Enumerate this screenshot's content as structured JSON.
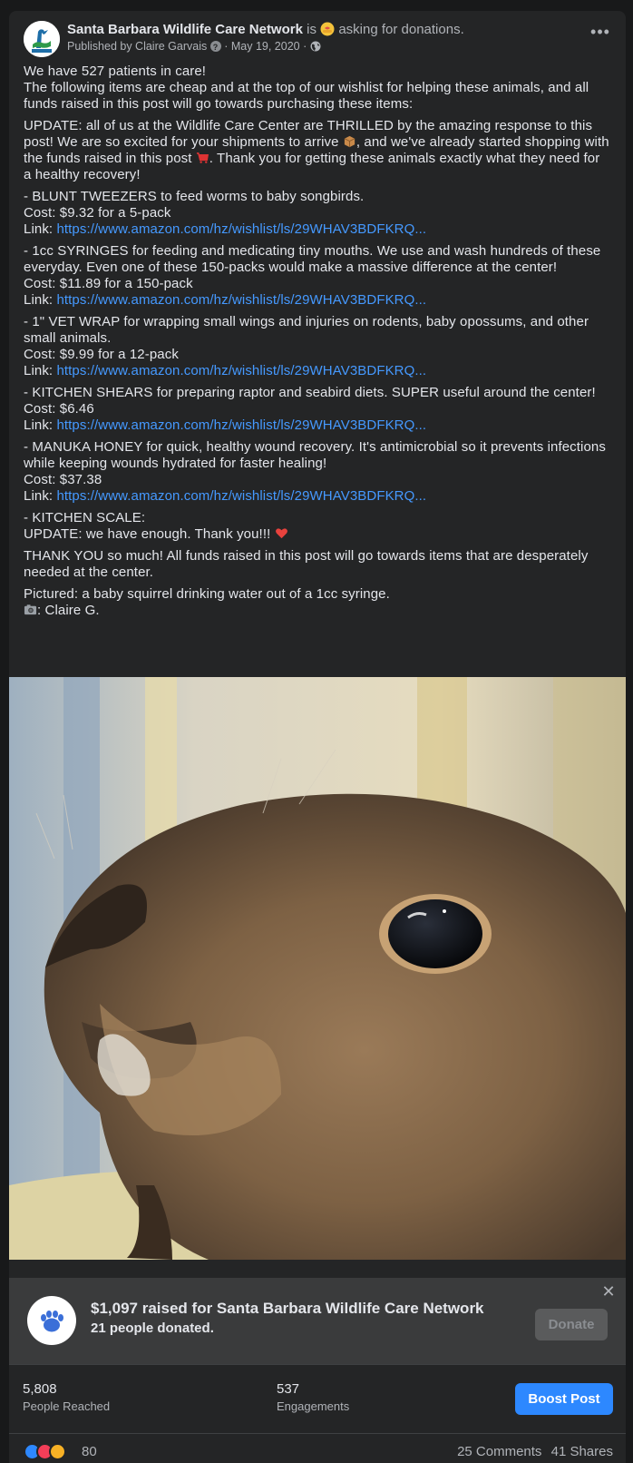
{
  "header": {
    "page_name": "Santa Barbara Wildlife Care Network",
    "status_prefix": "is",
    "status_text": "asking for donations.",
    "published_by": "Published by Claire Garvais",
    "date": "May 19, 2020",
    "separator": "·"
  },
  "post": {
    "intro_1": "We have 527 patients in care!",
    "intro_2": "The following items are cheap and at the top of our wishlist for helping these animals, and all funds raised in this post will go towards purchasing these items:",
    "update_1": "UPDATE: all of us at the Wildlife Care Center are THRILLED by the amazing response to this post! We are so excited for your shipments to arrive",
    "update_2": ", and we've already started shopping with the funds raised in this post",
    "update_3": ". Thank you for getting these animals exactly what they need for a healthy recovery!",
    "items": [
      {
        "desc": "- BLUNT TWEEZERS to feed worms to baby songbirds.",
        "cost": "Cost: $9.32 for a 5-pack",
        "link_label": "Link: ",
        "link": "https://www.amazon.com/hz/wishlist/ls/29WHAV3BDFKRQ..."
      },
      {
        "desc": "- 1cc SYRINGES for feeding and medicating tiny mouths. We use and wash hundreds of these everyday. Even one of these 150-packs would make a massive difference at the center!",
        "cost": "Cost: $11.89 for a 150-pack",
        "link_label": "Link: ",
        "link": "https://www.amazon.com/hz/wishlist/ls/29WHAV3BDFKRQ..."
      },
      {
        "desc": "- 1\" VET WRAP for wrapping small wings and injuries on rodents, baby opossums, and other small animals.",
        "cost": "Cost: $9.99 for a 12-pack",
        "link_label": "Link: ",
        "link": "https://www.amazon.com/hz/wishlist/ls/29WHAV3BDFKRQ..."
      },
      {
        "desc": "- KITCHEN SHEARS for preparing raptor and seabird diets. SUPER useful around the center!",
        "cost": "Cost: $6.46",
        "link_label": "Link: ",
        "link": "https://www.amazon.com/hz/wishlist/ls/29WHAV3BDFKRQ..."
      },
      {
        "desc": "- MANUKA HONEY for quick, healthy wound recovery. It's antimicrobial so it prevents infections while keeping wounds hydrated for faster healing!",
        "cost": "Cost: $37.38",
        "link_label": "Link: ",
        "link": "https://www.amazon.com/hz/wishlist/ls/29WHAV3BDFKRQ..."
      }
    ],
    "scale_1": "- KITCHEN SCALE:",
    "scale_2": "UPDATE: we have enough. Thank you!!!",
    "thanks": "THANK YOU so much! All funds raised in this post will go towards items that are desperately needed at the center.",
    "pictured": "Pictured: a baby squirrel drinking water out of a 1cc syringe.",
    "credit": ": Claire G."
  },
  "fundraiser": {
    "title": "$1,097 raised for Santa Barbara Wildlife Care Network",
    "subtitle": "21 people donated.",
    "donate_label": "Donate",
    "close": "✕"
  },
  "stats": {
    "reached_value": "5,808",
    "reached_label": "People Reached",
    "engagements_value": "537",
    "engagements_label": "Engagements",
    "boost_label": "Boost Post"
  },
  "reactions": {
    "count": "80",
    "comments": "25 Comments",
    "shares": "41 Shares"
  },
  "icons": {
    "more": "more-options-icon",
    "globe": "globe-icon",
    "paw": "paw-icon"
  },
  "colors": {
    "background": "#242526",
    "link": "#4599ff",
    "boost": "#2d88ff",
    "fund_bg": "#3a3b3c"
  }
}
